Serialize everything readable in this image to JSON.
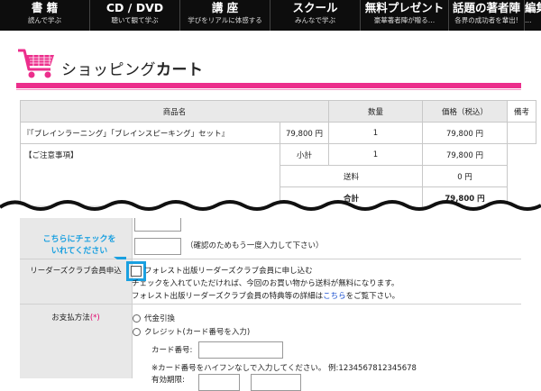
{
  "nav": [
    {
      "title": "書 籍",
      "sub": "読んで学ぶ"
    },
    {
      "title": "CD / DVD",
      "sub": "聴いて観て学ぶ"
    },
    {
      "title": "講 座",
      "sub": "学びをリアルに体感する"
    },
    {
      "title": "スクール",
      "sub": "みんなで学ぶ"
    },
    {
      "title": "無料プレゼント",
      "sub": "豪華著者陣が贈る…"
    },
    {
      "title": "話題の著者陣",
      "sub": "各界の成功者を輩出!"
    },
    {
      "title": "編集",
      "sub": "…"
    }
  ],
  "page": {
    "title_plain": "ショッピング",
    "title_bold": "カート"
  },
  "cart": {
    "headers": {
      "product": "商品名",
      "qty": "数量",
      "price": "価格（税込）",
      "note": "備考"
    },
    "rows": [
      {
        "product": "『「ブレインラーニング」「ブレインスピーキング」セット』",
        "unit": "79,800 円",
        "qty": "1",
        "price": "79,800 円",
        "note": ""
      }
    ],
    "notice_label": "【ご注意事項】",
    "subtotal_label": "小計",
    "subtotal_qty": "1",
    "subtotal_price": "79,800 円",
    "shipping_label": "送料",
    "shipping_price": "0 円",
    "total_label": "合計",
    "total_price": "79,800 円"
  },
  "form": {
    "confirm_note": "（確認のためもう一度入力して下さい）",
    "hint": "こちらにチェックを\nいれてください",
    "club_label": "リーダーズクラブ会員申込",
    "club_checkbox": "フォレスト出版リーダーズクラブ会員に申し込む",
    "club_desc1": "チェックを入れていただければ、今回のお買い物から送料が無料になります。",
    "club_desc2_pre": "フォレスト出版リーダーズクラブ会員の特典等の詳細は",
    "club_desc2_link": "こちら",
    "club_desc2_post": "をご覧下さい。",
    "payment_label": "お支払方法",
    "required_mark": "(*)",
    "payment_options": [
      "代金引換",
      "クレジット(カード番号を入力)"
    ],
    "card_label": "カード番号:",
    "card_note": "※カード番号をハイフンなしで入力してください。 例:1234567812345678",
    "expiry_label": "有効期限:"
  }
}
